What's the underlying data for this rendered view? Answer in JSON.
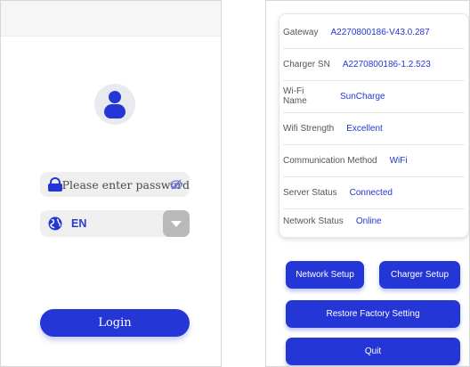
{
  "login_screen": {
    "password_placeholder": "Please enter password",
    "language_value": "EN",
    "login_label": "Login",
    "icons": [
      "user-avatar-icon",
      "lock-icon",
      "eye-slash-icon",
      "globe-icon",
      "dropdown-arrow-icon"
    ]
  },
  "info_screen": {
    "rows": [
      {
        "label": "Gateway",
        "value": "A2270800186-V43.0.287"
      },
      {
        "label": "Charger SN",
        "value": "A2270800186-1.2.523"
      },
      {
        "label": "Wi-Fi Name",
        "value": "SunCharge"
      },
      {
        "label": "Wifi Strength",
        "value": "Excellent"
      },
      {
        "label": "Communication Method",
        "value": "WiFi"
      },
      {
        "label": "Server Status",
        "value": "Connected"
      },
      {
        "label": "Network Status",
        "value": "Online"
      }
    ],
    "buttons": {
      "network_setup": "Network Setup",
      "charger_setup": "Charger Setup",
      "restore": "Restore Factory Setting",
      "quit": "Quit"
    }
  },
  "colors": {
    "accent": "#2436d6",
    "field_bg": "#efefef",
    "label_text": "#555555"
  }
}
